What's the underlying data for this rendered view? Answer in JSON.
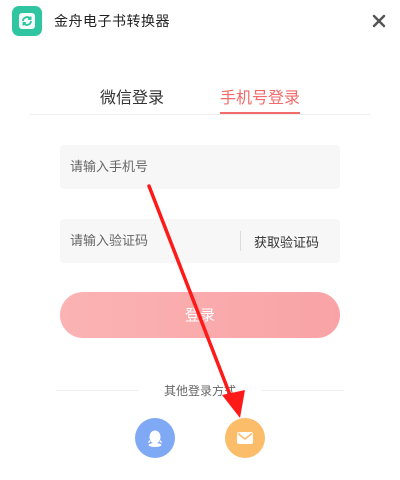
{
  "app": {
    "title": "金舟电子书转换器",
    "brand_color": "#2fc5a0"
  },
  "tabs": [
    {
      "label": "微信登录",
      "active": false
    },
    {
      "label": "手机号登录",
      "active": true
    }
  ],
  "accent_color": "#f26a6a",
  "form": {
    "phone_placeholder": "请输入手机号",
    "phone_value": "",
    "code_placeholder": "请输入验证码",
    "code_value": "",
    "get_code_label": "获取验证码",
    "login_label": "登录"
  },
  "other_methods": {
    "label": "其他登录方式",
    "items": [
      {
        "icon": "qq-penguin-icon",
        "color": "#7fa8f5"
      },
      {
        "icon": "mail-icon",
        "color": "#fbbd6a"
      }
    ]
  },
  "annotation": {
    "color": "#ff1a1a",
    "description_icon": "red-arrow"
  }
}
